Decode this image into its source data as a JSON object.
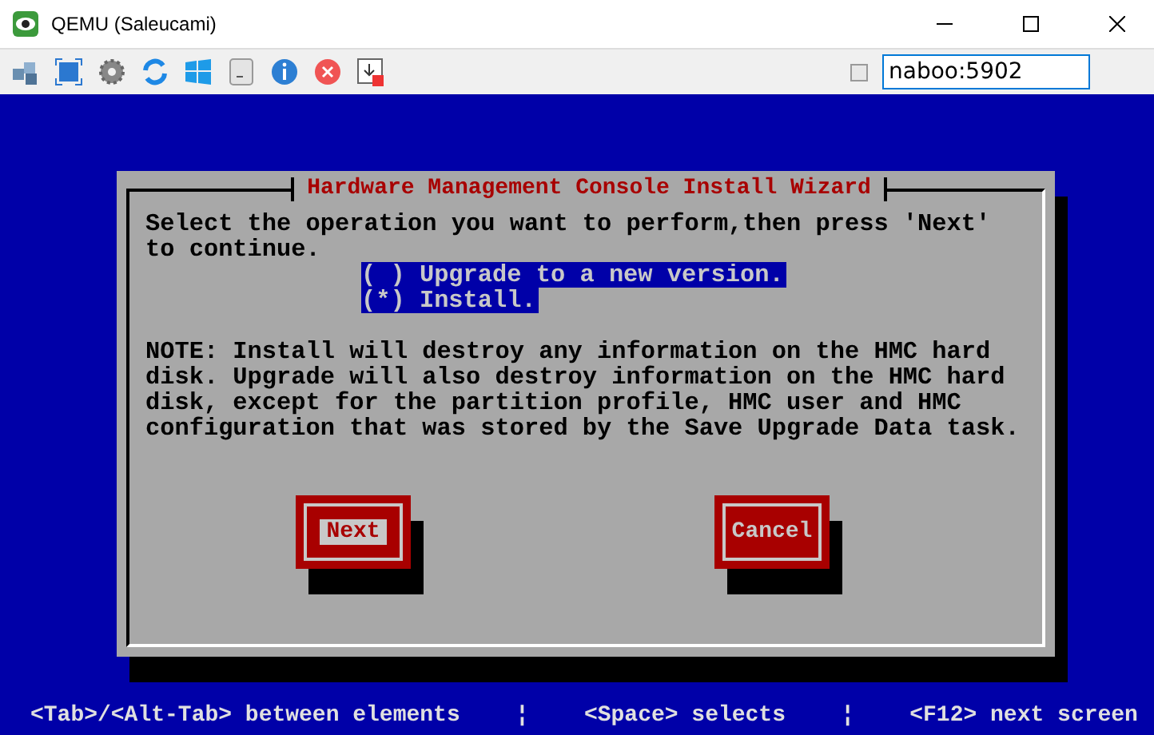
{
  "window": {
    "title": "QEMU (Saleucami)"
  },
  "toolbar": {
    "checked": false,
    "address": "naboo:5902"
  },
  "dialog": {
    "title": "Hardware Management Console Install Wizard",
    "prompt": "Select the operation you want to perform,then press 'Next' to continue.",
    "options": [
      {
        "label": "( ) Upgrade to a new version."
      },
      {
        "label": "(*) Install."
      }
    ],
    "note": "NOTE: Install will destroy any information on the HMC hard disk. Upgrade will also destroy information on the HMC hard disk, except for the partition profile, HMC user and HMC configuration that was stored by the Save Upgrade Data task.",
    "buttons": [
      {
        "label": "Next",
        "focused": true
      },
      {
        "label": "Cancel",
        "focused": false
      }
    ]
  },
  "status_bar": [
    "<Tab>/<Alt-Tab> between elements",
    "¦",
    "<Space> selects",
    "¦",
    "<F12> next screen"
  ]
}
